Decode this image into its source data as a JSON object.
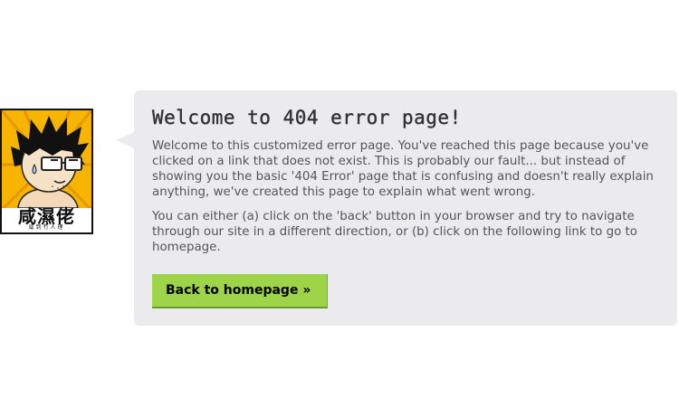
{
  "avatar": {
    "logo_text": "咸濕佬",
    "tagline": "咸到冇人理"
  },
  "error_page": {
    "title": "Welcome to 404 error page!",
    "paragraph_1": "Welcome to this customized error page. You've reached this page because you've clicked on a link that does not exist. This is probably our fault... but instead of showing you the basic '404 Error' page that is confusing and doesn't really explain anything, we've created this page to explain what went wrong.",
    "paragraph_2": "You can either (a) click on the 'back' button in your browser and try to navigate through our site in a different direction, or (b) click on the following link to go to homepage.",
    "back_button_label": "Back to homepage »"
  },
  "colors": {
    "bubble_background": "#ebebed",
    "button_background": "#9ed44a",
    "avatar_background": "#f7b500"
  }
}
